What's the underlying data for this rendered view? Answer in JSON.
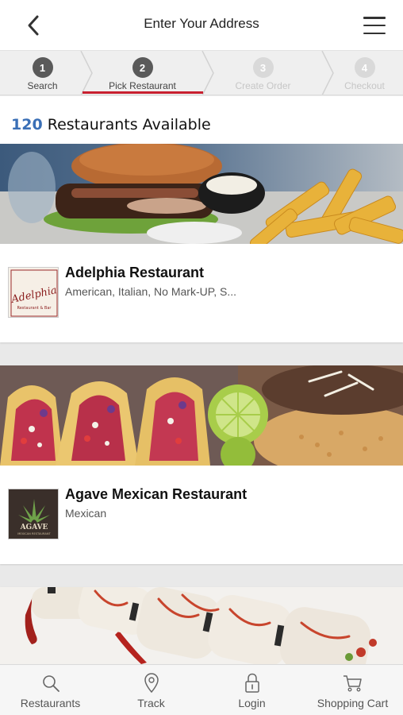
{
  "header": {
    "title": "Enter Your Address"
  },
  "steps": [
    {
      "num": "1",
      "label": "Search",
      "state": "done"
    },
    {
      "num": "2",
      "label": "Pick Restaurant",
      "state": "active"
    },
    {
      "num": "3",
      "label": "Create Order",
      "state": "future"
    },
    {
      "num": "4",
      "label": "Checkout",
      "state": "future"
    }
  ],
  "results": {
    "count": "120",
    "label": "Restaurants Available"
  },
  "restaurants": [
    {
      "name": "Adelphia Restaurant",
      "cuisine": "American, Italian, No Mark-UP, S...",
      "logo_text": "Adelphia",
      "logo_subtext": "Restaurant & Bar"
    },
    {
      "name": "Agave Mexican Restaurant",
      "cuisine": "Mexican",
      "logo_text": "AGAVE",
      "logo_subtext": "MEXICAN RESTAURANT"
    },
    {
      "name": "",
      "cuisine": ""
    }
  ],
  "bottom_nav": [
    {
      "label": "Restaurants",
      "icon": "search-icon"
    },
    {
      "label": "Track",
      "icon": "location-pin-icon"
    },
    {
      "label": "Login",
      "icon": "lock-icon"
    },
    {
      "label": "Shopping Cart",
      "icon": "cart-icon"
    }
  ],
  "colors": {
    "accent": "#c8202f",
    "count": "#3a6fb6",
    "step_active": "#5a5a5a",
    "step_future": "#d9d9d9"
  }
}
